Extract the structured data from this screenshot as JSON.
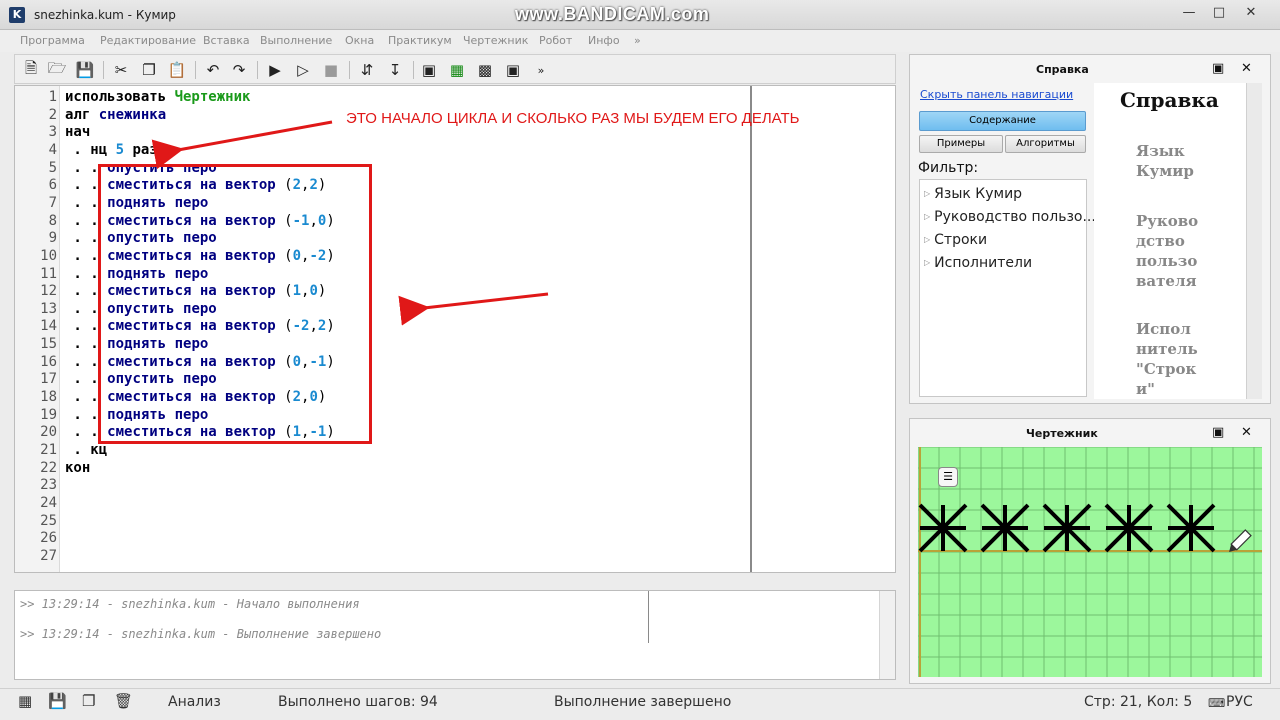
{
  "window": {
    "app_icon_letter": "K",
    "title": "snezhinka.kum - Кумир",
    "watermark": "www.BANDICAM.com"
  },
  "menu": [
    "Программа",
    "Редактирование",
    "Вставка",
    "Выполнение",
    "Окна",
    "Практикум",
    "Чертежник",
    "Робот",
    "Инфо",
    "»"
  ],
  "toolbar": {
    "overflow": "»"
  },
  "editor": {
    "lines": [
      [
        {
          "t": "использовать ",
          "c": "kw"
        },
        {
          "t": "Чертежник",
          "c": "green"
        }
      ],
      [
        {
          "t": "алг ",
          "c": "kw"
        },
        {
          "t": "снежинка",
          "c": "blue"
        }
      ],
      [
        {
          "t": "нач",
          "c": "kw"
        }
      ],
      [
        {
          "t": " . нц ",
          "c": "kw"
        },
        {
          "t": "5",
          "c": "num"
        },
        {
          "t": " раз",
          "c": "kw"
        }
      ],
      [
        {
          "t": " . . ",
          "c": "kw"
        },
        {
          "t": "опустить перо",
          "c": "blue"
        }
      ],
      [
        {
          "t": " . . ",
          "c": "kw"
        },
        {
          "t": "сместиться на вектор ",
          "c": "blue"
        },
        {
          "t": "(",
          "c": "par"
        },
        {
          "t": "2",
          "c": "num"
        },
        {
          "t": ",",
          "c": "par"
        },
        {
          "t": "2",
          "c": "num"
        },
        {
          "t": ")",
          "c": "par"
        }
      ],
      [
        {
          "t": " . . ",
          "c": "kw"
        },
        {
          "t": "поднять перо",
          "c": "blue"
        }
      ],
      [
        {
          "t": " . . ",
          "c": "kw"
        },
        {
          "t": "сместиться на вектор ",
          "c": "blue"
        },
        {
          "t": "(",
          "c": "par"
        },
        {
          "t": "-1",
          "c": "num"
        },
        {
          "t": ",",
          "c": "par"
        },
        {
          "t": "0",
          "c": "num"
        },
        {
          "t": ")",
          "c": "par"
        }
      ],
      [
        {
          "t": " . . ",
          "c": "kw"
        },
        {
          "t": "опустить перо",
          "c": "blue"
        }
      ],
      [
        {
          "t": " . . ",
          "c": "kw"
        },
        {
          "t": "сместиться на вектор ",
          "c": "blue"
        },
        {
          "t": "(",
          "c": "par"
        },
        {
          "t": "0",
          "c": "num"
        },
        {
          "t": ",",
          "c": "par"
        },
        {
          "t": "-2",
          "c": "num"
        },
        {
          "t": ")",
          "c": "par"
        }
      ],
      [
        {
          "t": " . . ",
          "c": "kw"
        },
        {
          "t": "поднять перо",
          "c": "blue"
        }
      ],
      [
        {
          "t": " . . ",
          "c": "kw"
        },
        {
          "t": "сместиться на вектор ",
          "c": "blue"
        },
        {
          "t": "(",
          "c": "par"
        },
        {
          "t": "1",
          "c": "num"
        },
        {
          "t": ",",
          "c": "par"
        },
        {
          "t": "0",
          "c": "num"
        },
        {
          "t": ")",
          "c": "par"
        }
      ],
      [
        {
          "t": " . . ",
          "c": "kw"
        },
        {
          "t": "опустить перо",
          "c": "blue"
        }
      ],
      [
        {
          "t": " . . ",
          "c": "kw"
        },
        {
          "t": "сместиться на вектор ",
          "c": "blue"
        },
        {
          "t": "(",
          "c": "par"
        },
        {
          "t": "-2",
          "c": "num"
        },
        {
          "t": ",",
          "c": "par"
        },
        {
          "t": "2",
          "c": "num"
        },
        {
          "t": ")",
          "c": "par"
        }
      ],
      [
        {
          "t": " . . ",
          "c": "kw"
        },
        {
          "t": "поднять перо",
          "c": "blue"
        }
      ],
      [
        {
          "t": " . . ",
          "c": "kw"
        },
        {
          "t": "сместиться на вектор ",
          "c": "blue"
        },
        {
          "t": "(",
          "c": "par"
        },
        {
          "t": "0",
          "c": "num"
        },
        {
          "t": ",",
          "c": "par"
        },
        {
          "t": "-1",
          "c": "num"
        },
        {
          "t": ")",
          "c": "par"
        }
      ],
      [
        {
          "t": " . . ",
          "c": "kw"
        },
        {
          "t": "опустить перо",
          "c": "blue"
        }
      ],
      [
        {
          "t": " . . ",
          "c": "kw"
        },
        {
          "t": "сместиться на вектор ",
          "c": "blue"
        },
        {
          "t": "(",
          "c": "par"
        },
        {
          "t": "2",
          "c": "num"
        },
        {
          "t": ",",
          "c": "par"
        },
        {
          "t": "0",
          "c": "num"
        },
        {
          "t": ")",
          "c": "par"
        }
      ],
      [
        {
          "t": " . . ",
          "c": "kw"
        },
        {
          "t": "поднять перо",
          "c": "blue"
        }
      ],
      [
        {
          "t": " . . ",
          "c": "kw"
        },
        {
          "t": "сместиться на вектор ",
          "c": "blue"
        },
        {
          "t": "(",
          "c": "par"
        },
        {
          "t": "1",
          "c": "num"
        },
        {
          "t": ",",
          "c": "par"
        },
        {
          "t": "-1",
          "c": "num"
        },
        {
          "t": ")",
          "c": "par"
        }
      ],
      [
        {
          "t": " . кц",
          "c": "kw"
        }
      ],
      [
        {
          "t": "кон",
          "c": "kw"
        }
      ],
      [],
      [],
      [],
      [],
      []
    ],
    "annotation": "ЭТО НАЧАЛО ЦИКЛА И СКОЛЬКО РАЗ МЫ БУДЕМ ЕГО ДЕЛАТЬ"
  },
  "console": {
    "messages": [
      ">> 13:29:14 - snezhinka.kum - Начало выполнения",
      ">> 13:29:14 - snezhinka.kum - Выполнение завершено"
    ]
  },
  "statusbar": {
    "mode": "Анализ",
    "steps": "Выполнено шагов: 94",
    "state": "Выполнение завершено",
    "cursor": "Стр: 21, Кол: 5",
    "lang": "РУС"
  },
  "help": {
    "title": "Справка",
    "hide_nav": "Скрыть панель навигации",
    "tab_contents": "Содержание",
    "tab_examples": "Примеры",
    "tab_algorithms": "Алгоритмы",
    "filter_label": "Фильтр:",
    "tree": [
      "Язык Кумир",
      "Руководство пользо...",
      "Строки",
      "Исполнители"
    ],
    "content_heading": "Справка",
    "content_links": [
      [
        "Язык",
        "Кумир"
      ],
      [
        "Руково",
        "дство",
        "пользо",
        "вателя"
      ],
      [
        "Испол",
        "нитель",
        "\"Строк",
        "и\""
      ]
    ]
  },
  "drawer": {
    "title": "Чертежник",
    "snowflake_count": 5,
    "colors": {
      "background": "#9cf79c",
      "grid": "#6fbf6f",
      "axis": "#b9a338",
      "ink": "#000000"
    }
  }
}
